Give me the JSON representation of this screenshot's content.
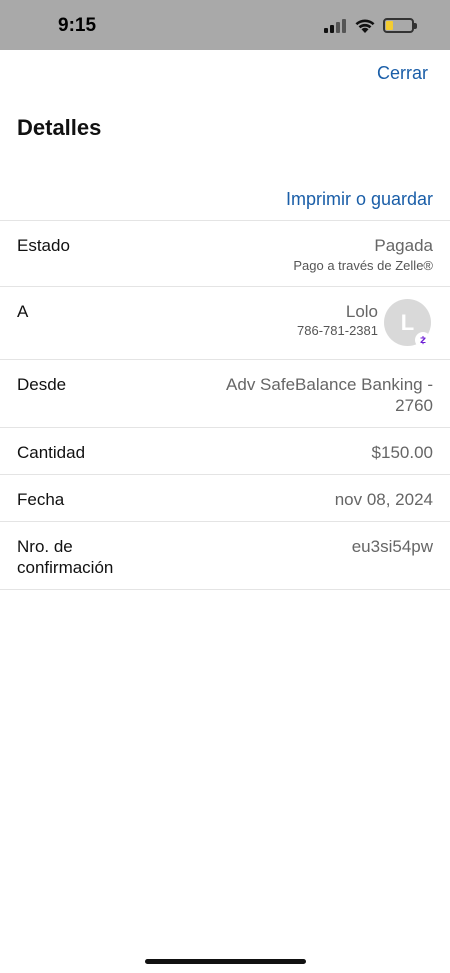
{
  "status_bar": {
    "time": "9:15",
    "signal_icon": "cellular-signal-icon",
    "wifi_icon": "wifi-icon",
    "battery_icon": "battery-icon",
    "battery_level": 0.2,
    "battery_color": "#f3cc31"
  },
  "header": {
    "close_label": "Cerrar",
    "title": "Detalles",
    "print_label": "Imprimir o guardar"
  },
  "details": {
    "status": {
      "label": "Estado",
      "value": "Pagada",
      "sub": "Pago a través de Zelle®"
    },
    "to": {
      "label": "A",
      "name": "Lolo",
      "phone": "786-781-2381",
      "avatar_initial": "L",
      "badge_icon": "zelle-icon"
    },
    "from": {
      "label": "Desde",
      "value_line1": "Adv SafeBalance Banking -",
      "value_line2": "2760"
    },
    "amount": {
      "label": "Cantidad",
      "value": "$150.00"
    },
    "date": {
      "label": "Fecha",
      "value": "nov 08, 2024"
    },
    "confirmation": {
      "label_line1": "Nro. de",
      "label_line2": "confirmación",
      "value": "eu3si54pw"
    }
  },
  "colors": {
    "link": "#1a5ea8",
    "status_bar_bg": "#a9a9a9",
    "zelle_purple": "#6d1ed4"
  }
}
